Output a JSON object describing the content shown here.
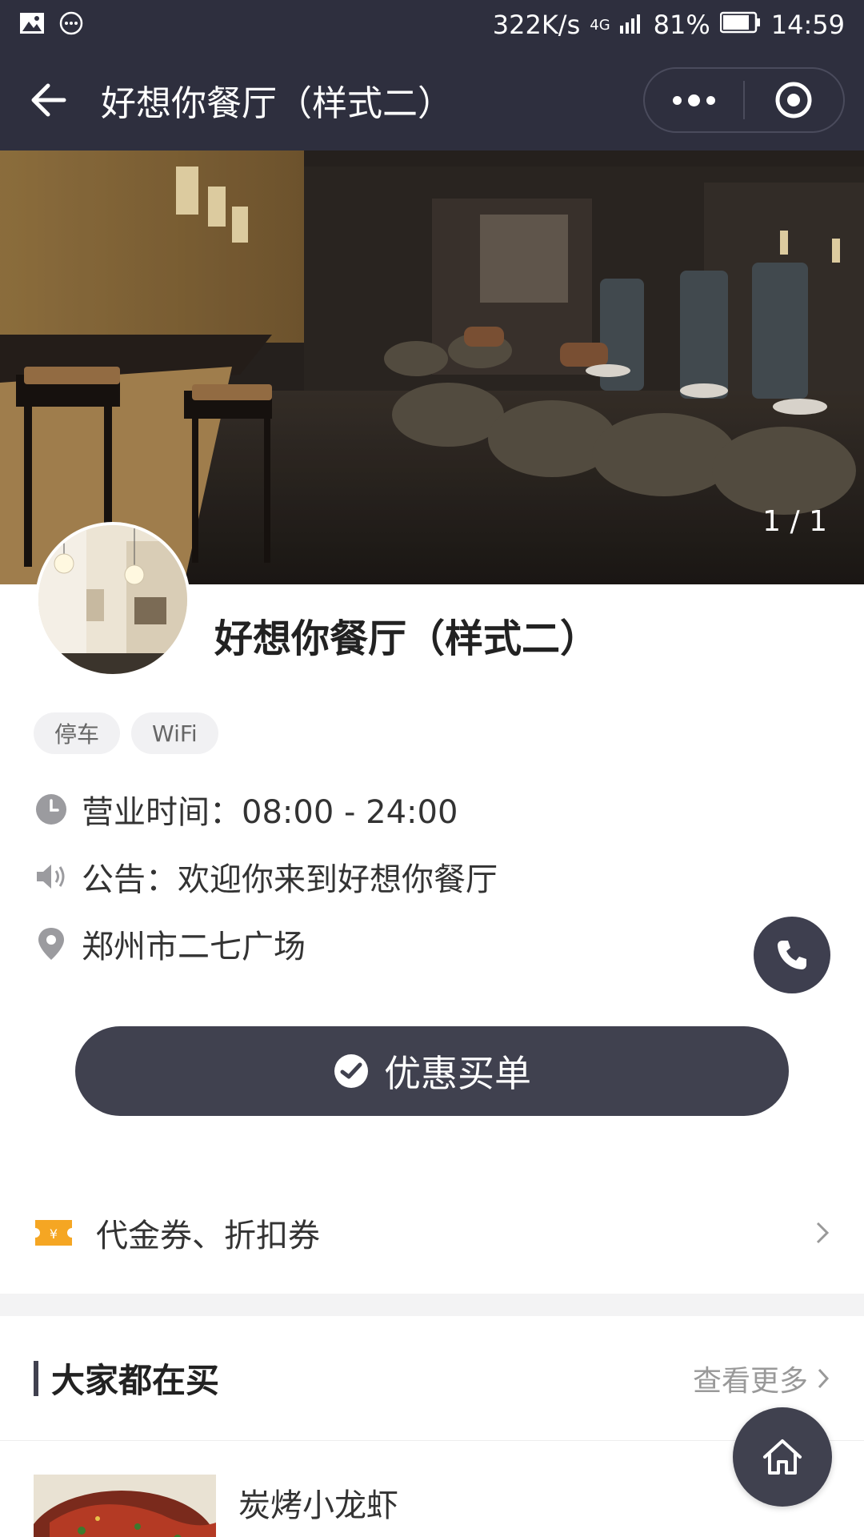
{
  "status_bar": {
    "speed": "322K/s",
    "network": "4G",
    "battery": "81%",
    "time": "14:59"
  },
  "nav": {
    "title": "好想你餐厅（样式二）"
  },
  "hero": {
    "counter": "1 / 1"
  },
  "shop": {
    "name": "好想你餐厅（样式二）",
    "tags": [
      "停车",
      "WiFi"
    ],
    "hours": "营业时间：08:00 - 24:00",
    "notice": "公告：欢迎你来到好想你餐厅",
    "address": "郑州市二七广场"
  },
  "pay_button": {
    "label": "优惠买单"
  },
  "coupon": {
    "label": "代金券、折扣券"
  },
  "section": {
    "title": "大家都在买",
    "more": "查看更多"
  },
  "products": [
    {
      "name": "炭烤小龙虾"
    }
  ],
  "colors": {
    "header_bg": "#2e2f3e",
    "button_bg": "#40414f",
    "coupon_icon": "#f5a623"
  },
  "icons": {
    "back": "arrow-left-icon",
    "more": "more-dots-icon",
    "close": "target-circle-icon",
    "clock": "clock-icon",
    "notice": "speaker-icon",
    "location": "location-pin-icon",
    "phone": "phone-icon",
    "pay": "wechat-pay-icon",
    "coupon": "ticket-icon",
    "home": "home-icon"
  }
}
